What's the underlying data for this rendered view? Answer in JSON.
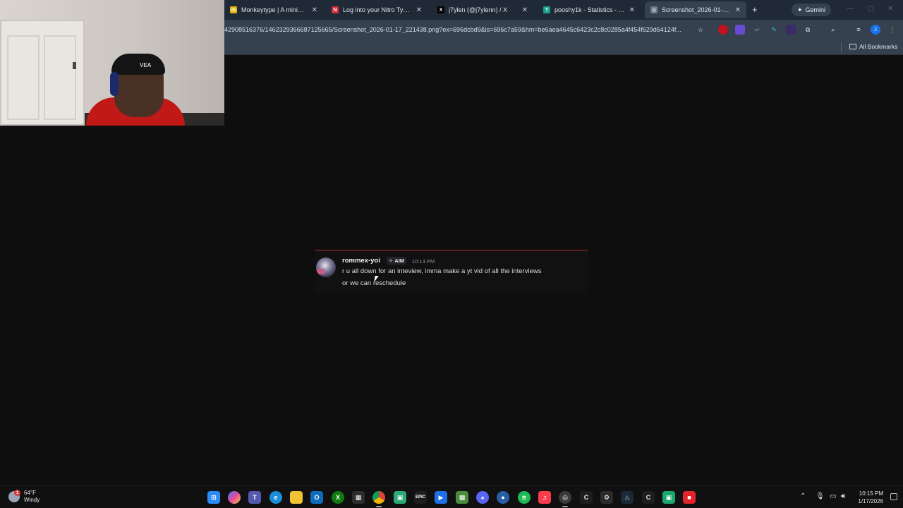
{
  "browser": {
    "tabs": [
      {
        "title": "Monkeytype | A minimalistic...",
        "favicon": "monkeytype-icon",
        "color": "#e2b714",
        "glyph": "m"
      },
      {
        "title": "Log into your Nitro Type acc...",
        "favicon": "nitro-type-icon",
        "color": "#d62f3a",
        "glyph": "N"
      },
      {
        "title": "j7ylen (@j7ylenn) / X",
        "favicon": "x-icon",
        "color": "#000000",
        "glyph": "X"
      },
      {
        "title": "pooshy1k - Statistics - Twitch...",
        "favicon": "twitchtracker-icon",
        "color": "#1aa18f",
        "glyph": "T"
      },
      {
        "title": "Screenshot_2026-01-17_221...",
        "favicon": "globe-icon",
        "color": "#6f7b88",
        "glyph": "◎",
        "active": true
      }
    ],
    "new_tab_label": "+",
    "gemini_label": "Gemini",
    "url": "42908516376/1462329366687125665/Screenshot_2026-01-17_221438.png?ex=696dcbd9&is=696c7a59&hm=be6aea4645c6423c2c8c0285a4f454f629d64124f...",
    "bookmarks_label": "All Bookmarks"
  },
  "webcam": {
    "beanie_text": "VEA"
  },
  "message": {
    "username": "rommex-yoi",
    "tag": "AIM",
    "timestamp": "10:14 PM",
    "line1": "r u all down for an inteview, imma make a yt vid of all the interviews",
    "line2": "or we can reschedule"
  },
  "taskbar": {
    "weather_temp": "64°F",
    "weather_desc": "Windy",
    "weather_badge": "1",
    "time": "10:15 PM",
    "date": "1/17/2026"
  }
}
